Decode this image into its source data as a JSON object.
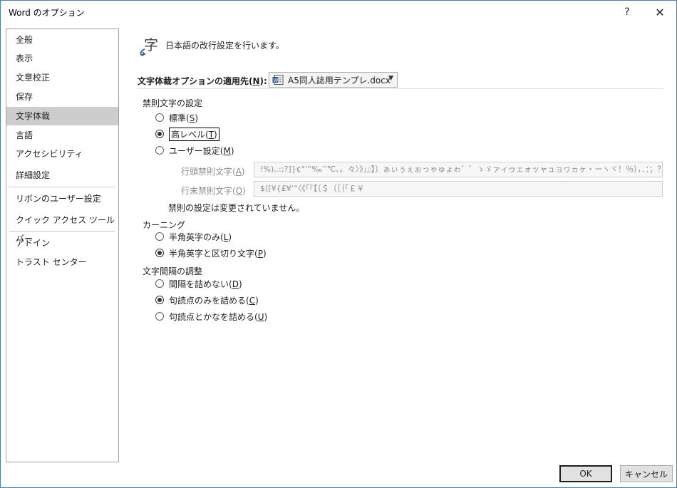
{
  "window": {
    "title": "Word のオプション",
    "help_icon": "?",
    "close_icon": "✕"
  },
  "sidebar": {
    "items": [
      {
        "label": "全般"
      },
      {
        "label": "表示"
      },
      {
        "label": "文章校正"
      },
      {
        "label": "保存"
      },
      {
        "label": "文字体裁",
        "selected": true
      },
      {
        "label": "言語"
      },
      {
        "label": "アクセシビリティ"
      },
      {
        "label": "詳細設定"
      },
      {
        "label": "リボンのユーザー設定"
      },
      {
        "label": "クイック アクセス ツール バー"
      },
      {
        "label": "アドイン"
      },
      {
        "label": "トラスト センター"
      }
    ]
  },
  "main": {
    "header_text": "日本語の改行設定を行います。",
    "header_icon": "typography-icon",
    "apply_label_pre": "文字体裁オプションの適用先(",
    "apply_label_key": "N",
    "apply_label_post": "):",
    "apply_target": "A5同人誌用テンプレ.docx",
    "kinsoku": {
      "title": "禁則文字の設定",
      "options": [
        {
          "label": "標準(",
          "key": "S",
          "post": ")",
          "checked": false
        },
        {
          "label": "高レベル(",
          "key": "T",
          "post": ")",
          "checked": true
        },
        {
          "label": "ユーザー設定(",
          "key": "M",
          "post": ")",
          "checked": false
        }
      ],
      "head_label": "行頭禁則文字(",
      "head_key": "A",
      "head_post": ")",
      "head_value": "!%),.:;?]}¢°’”‰′″℃、。々〉》」』】〕ぁぃぅぇぉっゃゅょゎ゛゜ゝゞァィゥェォッャュョヮヵヶ・ーヽヾ！％），．：；？］｝｡｣､･ｧｨ",
      "tail_label": "行末禁則文字(",
      "tail_key": "O",
      "tail_post": ")",
      "tail_value": "$([¥{£¥‘“〈《「『【〔＄（［｛｢￡￥",
      "note": "禁則の設定は変更されていません。"
    },
    "kerning": {
      "title": "カーニング",
      "options": [
        {
          "label": "半角英字のみ(",
          "key": "L",
          "post": ")",
          "checked": false
        },
        {
          "label": "半角英字と区切り文字(",
          "key": "P",
          "post": ")",
          "checked": true
        }
      ]
    },
    "spacing": {
      "title": "文字間隔の調整",
      "options": [
        {
          "label": "間隔を詰めない(",
          "key": "D",
          "post": ")",
          "checked": false
        },
        {
          "label": "句読点のみを詰める(",
          "key": "C",
          "post": ")",
          "checked": true
        },
        {
          "label": "句読点とかなを詰める(",
          "key": "U",
          "post": ")",
          "checked": false
        }
      ]
    }
  },
  "footer": {
    "ok_label": "OK",
    "cancel_label": "キャンセル"
  },
  "colors": {
    "selected_bg": "#cdcdcd",
    "border": "#a0a0a0",
    "accent": "#2b579a"
  }
}
